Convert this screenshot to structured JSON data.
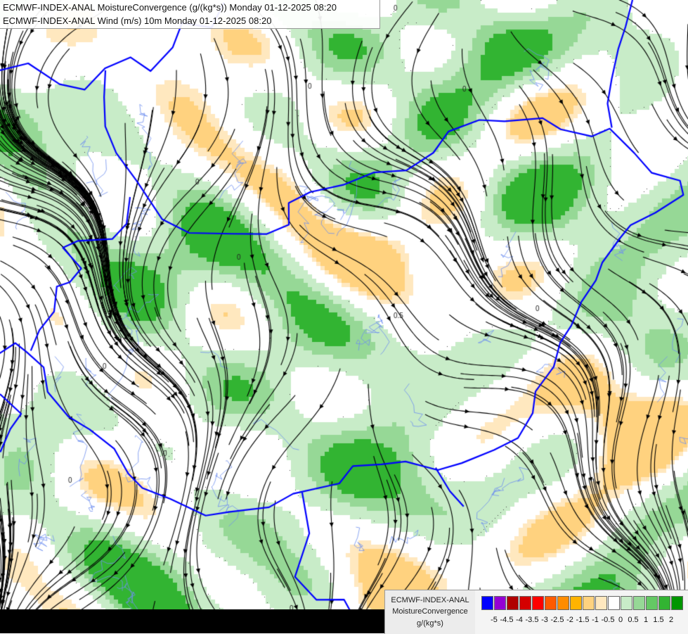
{
  "header": {
    "line1": "ECMWF-INDEX-ANAL MoistureConvergence (g/(kg*s)) Monday 01-12-2025 08:20",
    "line2": "ECMWF-INDEX-ANAL Wind (m/s) 10m Monday 01-12-2025 08:20"
  },
  "legend": {
    "model": "ECMWF-INDEX-ANAL",
    "parameter": "MoistureConvergence",
    "unit": "g/(kg*s)",
    "colors": [
      "#0000ff",
      "#9400d3",
      "#b00000",
      "#d40000",
      "#ff0000",
      "#ff5a00",
      "#ff8c00",
      "#ffb300",
      "#ffd27f",
      "#ffe8bf",
      "#ffffff",
      "#c8ecc8",
      "#96d896",
      "#64c864",
      "#32b432",
      "#009600"
    ],
    "ticks": [
      "-5",
      "-4.5",
      "-4",
      "-3.5",
      "-3",
      "-2.5",
      "-2",
      "-1.5",
      "-1",
      "-0.5",
      "0",
      "0.5",
      "1",
      "1.5",
      "2"
    ]
  },
  "map": {
    "contour_labels": [
      "0",
      "0",
      "0",
      "0",
      "0",
      "0",
      "0",
      "0",
      "0.5",
      "0",
      "0"
    ],
    "colors": {
      "background": "#ffffff",
      "convergence_light": "#c8ecc8",
      "convergence_mid": "#96d896",
      "convergence_strong": "#32b432",
      "divergence_light": "#ffe8bf",
      "divergence_mid": "#ffd27f",
      "streamline": "#000000",
      "border": "#0000ff",
      "river": "#6f8ff0",
      "contour": "#444444"
    }
  }
}
